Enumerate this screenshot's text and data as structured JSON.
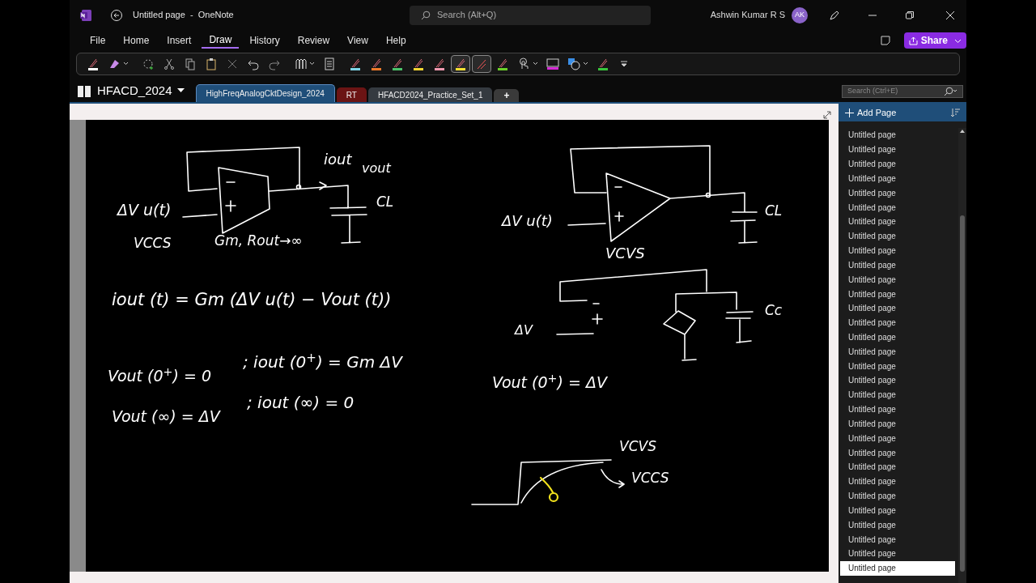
{
  "window": {
    "title": "Untitled page  -  OneNote",
    "search_placeholder": "Search (Alt+Q)",
    "user_name": "Ashwin Kumar R S",
    "user_initials": "AK"
  },
  "menu": [
    {
      "label": "File",
      "selected": false
    },
    {
      "label": "Home",
      "selected": false
    },
    {
      "label": "Insert",
      "selected": false
    },
    {
      "label": "Draw",
      "selected": true
    },
    {
      "label": "History",
      "selected": false
    },
    {
      "label": "Review",
      "selected": false
    },
    {
      "label": "View",
      "selected": false
    },
    {
      "label": "Help",
      "selected": false
    }
  ],
  "share_button": "Share",
  "toolbar": [
    {
      "kind": "pen",
      "color": "#ffffff",
      "selected": false
    },
    {
      "kind": "eraser",
      "dropdown": true
    },
    {
      "kind": "lasso"
    },
    {
      "kind": "cut"
    },
    {
      "kind": "copy"
    },
    {
      "kind": "paste"
    },
    {
      "kind": "delete"
    },
    {
      "kind": "undo"
    },
    {
      "kind": "redo"
    },
    {
      "kind": "pens",
      "dropdown": true
    },
    {
      "kind": "page"
    },
    {
      "kind": "pen",
      "color": "#7fd6e8",
      "selected": false
    },
    {
      "kind": "pen",
      "color": "#f07a2a",
      "selected": false
    },
    {
      "kind": "pen",
      "color": "#4cc36a",
      "selected": false
    },
    {
      "kind": "pen",
      "color": "#f5d532",
      "selected": false
    },
    {
      "kind": "pen",
      "color": "#f09ab0",
      "selected": false
    },
    {
      "kind": "pen",
      "color": "#f5e032",
      "selected": true
    },
    {
      "kind": "ruler",
      "selected": true
    },
    {
      "kind": "pen",
      "color": "#6ccf2a",
      "selected": false
    },
    {
      "kind": "touch",
      "dropdown": true
    },
    {
      "kind": "screen"
    },
    {
      "kind": "shapes",
      "dropdown": true
    },
    {
      "kind": "pen",
      "color": "#39c53d",
      "selected": false
    },
    {
      "kind": "more"
    }
  ],
  "notebook": {
    "name": "HFACD_2024",
    "search_placeholder": "Search (Ctrl+E)"
  },
  "sections": [
    {
      "label": "HighFreqAnalogCktDesign_2024",
      "color": "#1f4e79",
      "selected": true
    },
    {
      "label": "RT",
      "color": "#6b1414",
      "selected": false
    },
    {
      "label": "HFACD2024_Practice_Set_1",
      "color": "#353a40",
      "selected": false
    }
  ],
  "add_section": "+",
  "ink_notes": {
    "left_column": [
      {
        "text": "iout"
      },
      {
        "text": "vout"
      },
      {
        "text": "ΔV u(t)"
      },
      {
        "text": "CL"
      },
      {
        "text": "VCCS"
      },
      {
        "text": "Gm, Rout→∞"
      },
      {
        "text": "iout (t) = Gm (ΔV u(t) − Vout (t))"
      },
      {
        "text": "Vout (0$^{+}$) = 0"
      },
      {
        "text": ";  iout (0$^{+}$) = Gm ΔV"
      },
      {
        "text": "Vout (∞) = ΔV"
      },
      {
        "text": ";  iout (∞) = 0"
      }
    ],
    "right_column": [
      {
        "text": "ΔV u(t)"
      },
      {
        "text": "CL"
      },
      {
        "text": "VCVS"
      },
      {
        "text": "ΔV"
      },
      {
        "text": "Cc"
      },
      {
        "text": "Vout (0$^{+}$) = ΔV"
      },
      {
        "text": "VCVS"
      },
      {
        "text": "VCCS"
      }
    ]
  },
  "pages_panel": {
    "add_page": "Add Page",
    "pages": [
      {
        "title": "Untitled page",
        "selected": false
      },
      {
        "title": "Untitled page",
        "selected": false
      },
      {
        "title": "Untitled page",
        "selected": false
      },
      {
        "title": "Untitled page",
        "selected": false
      },
      {
        "title": "Untitled page",
        "selected": false
      },
      {
        "title": "Untitled page",
        "selected": false
      },
      {
        "title": "Untitled page",
        "selected": false
      },
      {
        "title": "Untitled page",
        "selected": false
      },
      {
        "title": "Untitled page",
        "selected": false
      },
      {
        "title": "Untitled page",
        "selected": false
      },
      {
        "title": "Untitled page",
        "selected": false
      },
      {
        "title": "Untitled page",
        "selected": false
      },
      {
        "title": "Untitled page",
        "selected": false
      },
      {
        "title": "Untitled page",
        "selected": false
      },
      {
        "title": "Untitled page",
        "selected": false
      },
      {
        "title": "Untitled page",
        "selected": false
      },
      {
        "title": "Untitled page",
        "selected": false
      },
      {
        "title": "Untitled page",
        "selected": false
      },
      {
        "title": "Untitled page",
        "selected": false
      },
      {
        "title": "Untitled page",
        "selected": false
      },
      {
        "title": "Untitled page",
        "selected": false
      },
      {
        "title": "Untitled page",
        "selected": false
      },
      {
        "title": "Untitled page",
        "selected": false
      },
      {
        "title": "Untitled page",
        "selected": false
      },
      {
        "title": "Untitled page",
        "selected": false
      },
      {
        "title": "Untitled page",
        "selected": false
      },
      {
        "title": "Untitled page",
        "selected": false
      },
      {
        "title": "Untitled page",
        "selected": false
      },
      {
        "title": "Untitled page",
        "selected": false
      },
      {
        "title": "Untitled page",
        "selected": false
      },
      {
        "title": "Untitled page",
        "selected": true
      }
    ]
  }
}
